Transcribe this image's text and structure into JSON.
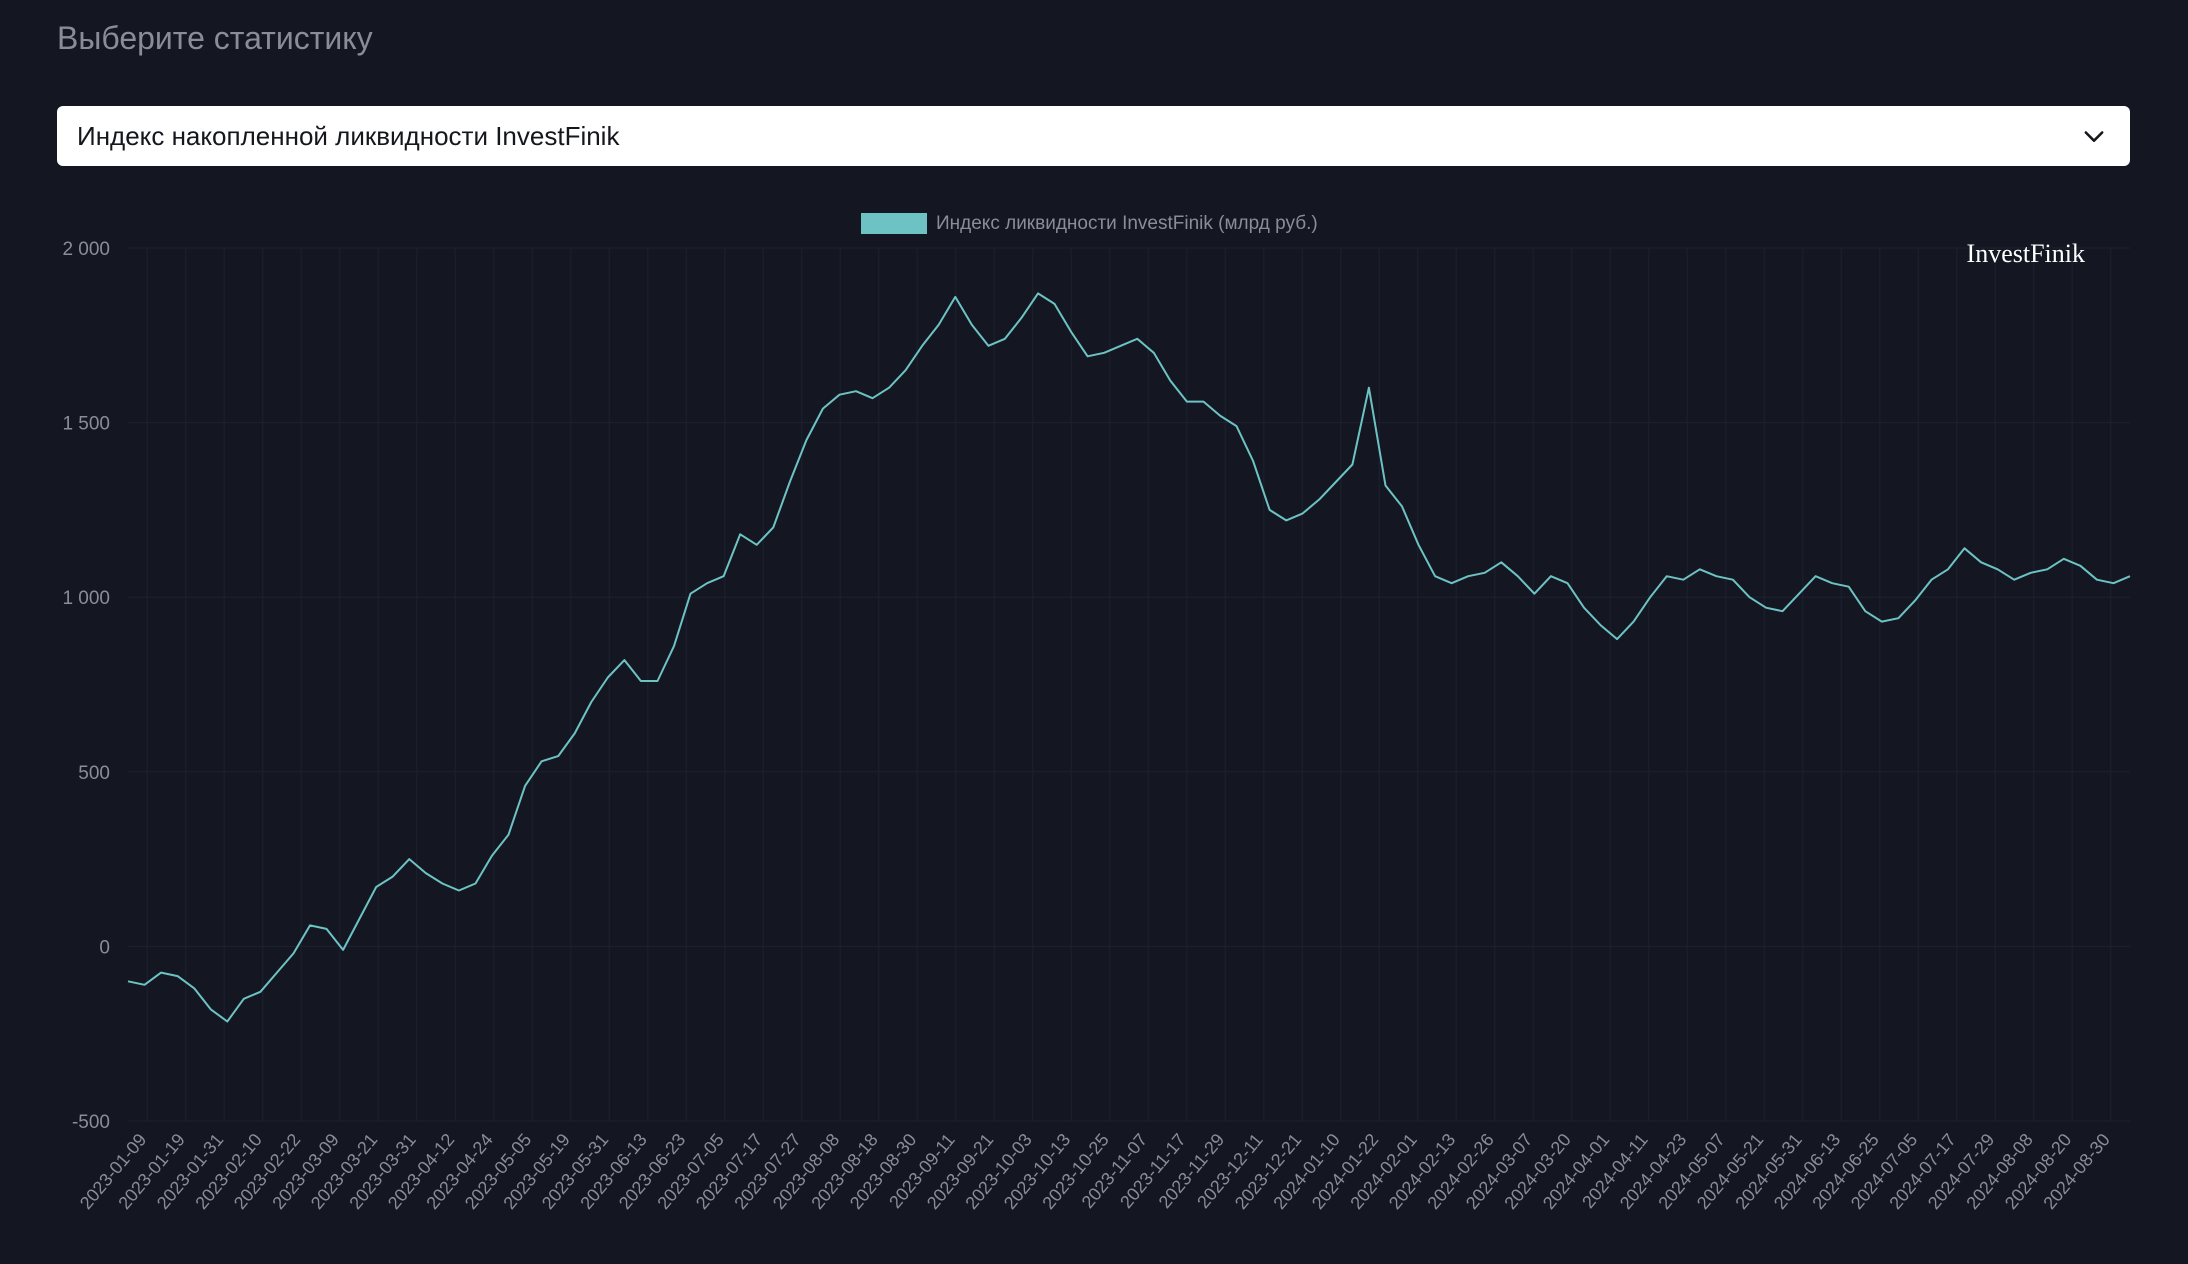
{
  "header": {
    "title": "Выберите статистику"
  },
  "select": {
    "value": "Индекс накопленной ликвидности InvestFinik"
  },
  "colors": {
    "background": "#141722",
    "line": "#6dc3c4",
    "grid": "#1c2130",
    "tick_text": "#8a8d96"
  },
  "chart_data": {
    "type": "line",
    "watermark": "InvestFinik",
    "legend_position": "top-center",
    "grid": true,
    "ylim": [
      -500,
      2000
    ],
    "yticks": [
      2000,
      1500,
      1000,
      500,
      0,
      -500
    ],
    "ytick_labels": [
      "2 000",
      "1 500",
      "1 000",
      "500",
      "0",
      "-500"
    ],
    "xtick_labels": [
      "2023-01-09",
      "2023-01-19",
      "2023-01-31",
      "2023-02-10",
      "2023-02-22",
      "2023-03-09",
      "2023-03-21",
      "2023-03-31",
      "2023-04-12",
      "2023-04-24",
      "2023-05-05",
      "2023-05-19",
      "2023-05-31",
      "2023-06-13",
      "2023-06-23",
      "2023-07-05",
      "2023-07-17",
      "2023-07-27",
      "2023-08-08",
      "2023-08-18",
      "2023-08-30",
      "2023-09-11",
      "2023-09-21",
      "2023-10-03",
      "2023-10-13",
      "2023-10-25",
      "2023-11-07",
      "2023-11-17",
      "2023-11-29",
      "2023-12-11",
      "2023-12-21",
      "2024-01-10",
      "2024-01-22",
      "2024-02-01",
      "2024-02-13",
      "2024-02-26",
      "2024-03-07",
      "2024-03-20",
      "2024-04-01",
      "2024-04-11",
      "2024-04-23",
      "2024-05-07",
      "2024-05-21",
      "2024-05-31",
      "2024-06-13",
      "2024-06-25",
      "2024-07-05",
      "2024-07-17",
      "2024-07-29",
      "2024-08-08",
      "2024-08-20",
      "2024-08-30"
    ],
    "series": [
      {
        "name": "Индекс ликвидности InvestFinik (млрд руб.)",
        "color": "#6dc3c4",
        "values": [
          -100,
          -110,
          -75,
          -85,
          -120,
          -180,
          -215,
          -150,
          -130,
          -75,
          -20,
          60,
          50,
          -10,
          80,
          170,
          200,
          250,
          210,
          180,
          160,
          180,
          260,
          320,
          460,
          530,
          545,
          610,
          700,
          770,
          820,
          760,
          760,
          860,
          1010,
          1040,
          1060,
          1180,
          1150,
          1200,
          1330,
          1450,
          1540,
          1580,
          1590,
          1570,
          1600,
          1650,
          1720,
          1780,
          1860,
          1780,
          1720,
          1740,
          1800,
          1870,
          1840,
          1760,
          1690,
          1700,
          1720,
          1740,
          1700,
          1620,
          1560,
          1560,
          1520,
          1490,
          1390,
          1250,
          1220,
          1240,
          1280,
          1330,
          1380,
          1600,
          1320,
          1260,
          1150,
          1060,
          1040,
          1060,
          1070,
          1100,
          1060,
          1010,
          1060,
          1040,
          970,
          920,
          880,
          930,
          1000,
          1060,
          1050,
          1080,
          1060,
          1050,
          1000,
          970,
          960,
          1010,
          1060,
          1040,
          1030,
          960,
          930,
          940,
          990,
          1050,
          1080,
          1140,
          1100,
          1080,
          1050,
          1070,
          1080,
          1110,
          1090,
          1050,
          1040,
          1060
        ]
      }
    ]
  }
}
